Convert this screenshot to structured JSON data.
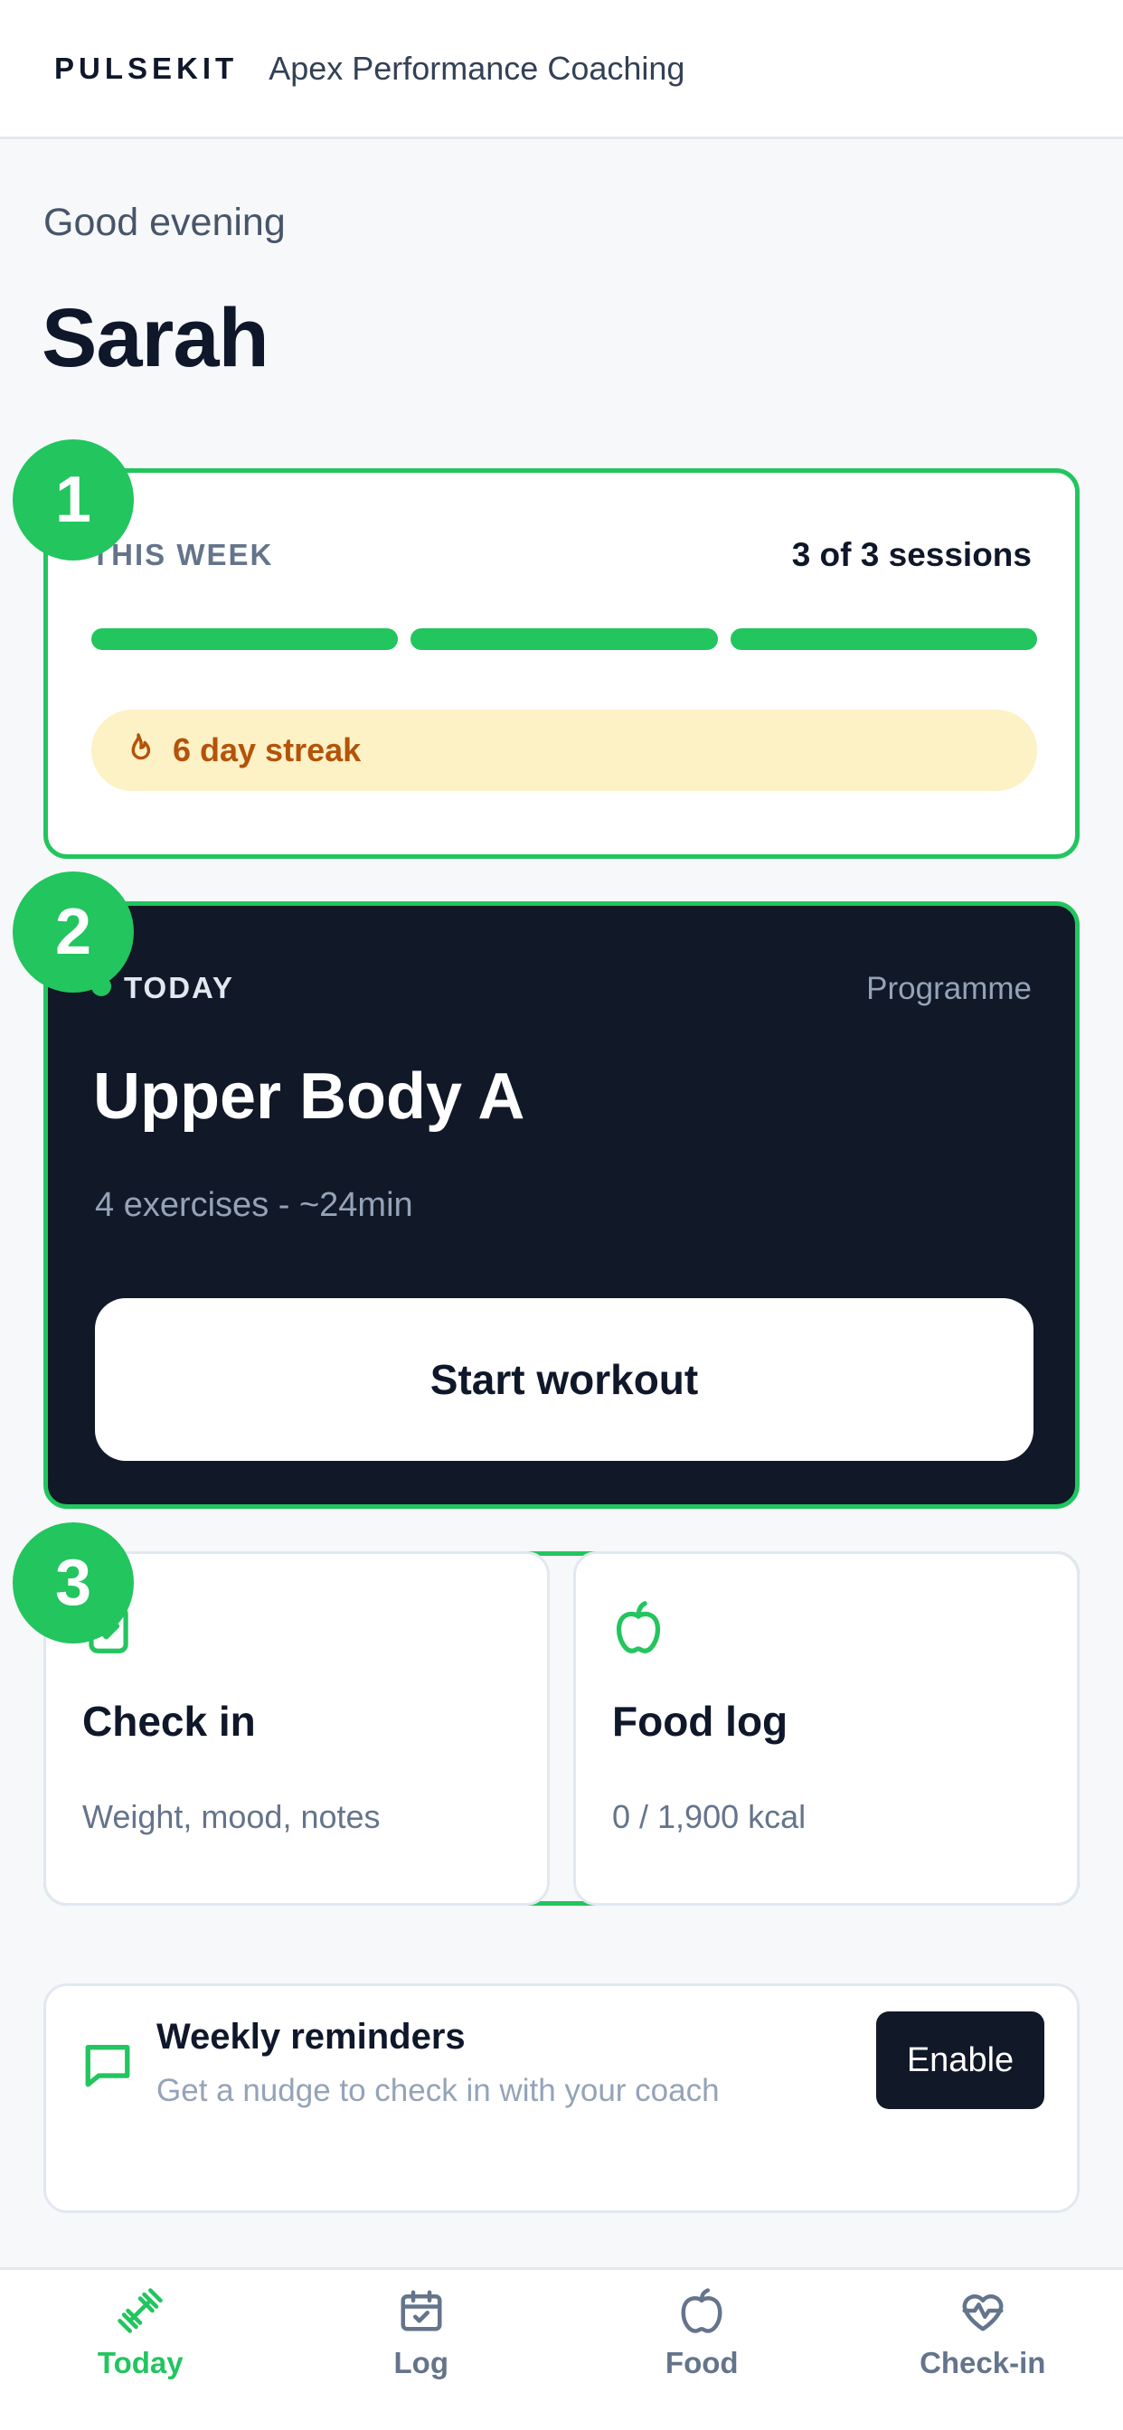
{
  "header": {
    "brand": "PULSEKIT",
    "coach_name": "Apex Performance Coaching"
  },
  "greeting": "Good evening",
  "user_name": "Sarah",
  "steps": [
    "1",
    "2",
    "3"
  ],
  "week_card": {
    "label": "THIS WEEK",
    "sessions_text": "3 of 3 sessions",
    "sessions_completed": 3,
    "sessions_total": 3,
    "streak_text": "6 day streak",
    "streak_icon": "flame-icon"
  },
  "today_card": {
    "label": "TODAY",
    "programme_link": "Programme",
    "workout_title": "Upper Body A",
    "workout_meta": "4 exercises - ~24min",
    "start_button": "Start workout"
  },
  "tiles": {
    "check_in": {
      "title": "Check in",
      "subtitle": "Weight, mood, notes",
      "icon": "clipboard-check-icon"
    },
    "food_log": {
      "title": "Food log",
      "subtitle": "0 / 1,900 kcal",
      "icon": "apple-icon"
    }
  },
  "reminders": {
    "title": "Weekly reminders",
    "subtitle": "Get a nudge to check in with your coach",
    "button": "Enable",
    "icon": "message-icon"
  },
  "nav": [
    {
      "label": "Today",
      "icon": "dumbbell-icon",
      "active": true
    },
    {
      "label": "Log",
      "icon": "calendar-check-icon",
      "active": false
    },
    {
      "label": "Food",
      "icon": "apple-icon",
      "active": false
    },
    {
      "label": "Check-in",
      "icon": "heart-pulse-icon",
      "active": false
    }
  ],
  "colors": {
    "accent": "#22c55e",
    "dark": "#111827",
    "streak_bg": "#fdf1c6",
    "streak_text": "#b45309"
  }
}
